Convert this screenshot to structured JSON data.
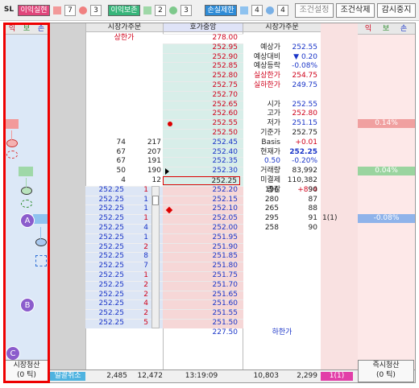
{
  "toolbar": {
    "sl": "SL",
    "profit_stop_tag": "이익실현",
    "n7": "7",
    "n3a": "3",
    "profit_keep_tag": "이익보존",
    "n2": "2",
    "n3b": "3",
    "loss_limit_tag": "손실제한",
    "n4a": "4",
    "n4b": "4",
    "cond_set": "조건설정",
    "cond_delete": "조건삭제",
    "monitor_stop": "감시중지"
  },
  "left_headers": [
    "익",
    "보",
    "손"
  ],
  "right_headers": [
    "익",
    "보",
    "손"
  ],
  "col_headers": {
    "market_order_left": "시장가주문",
    "center": "호가중앙",
    "market_order_right": "시장가주문"
  },
  "upper_limit_label": "상한가",
  "lower_limit_label": "하한가",
  "price_ladder": [
    "278.00",
    "252.95",
    "252.90",
    "252.85",
    "252.80",
    "252.75",
    "252.70",
    "252.65",
    "252.60",
    "252.55",
    "252.50",
    "252.45",
    "252.40",
    "252.35",
    "252.30",
    "252.25",
    "252.20",
    "252.15",
    "252.10",
    "252.05",
    "252.00",
    "251.95",
    "251.90",
    "251.85",
    "251.80",
    "251.75",
    "251.70",
    "251.65",
    "251.60",
    "251.55",
    "251.50",
    "227.50"
  ],
  "info_rows": [
    {
      "label": "예상가",
      "value": "252.55"
    },
    {
      "label": "예상대비",
      "value": "▼ 0.20"
    },
    {
      "label": "예상등락",
      "value": "-0.08%"
    },
    {
      "label": "실상한가",
      "value": "254.75"
    },
    {
      "label": "실하한가",
      "value": "249.75"
    },
    {
      "label": "",
      "value": ""
    },
    {
      "label": "시가",
      "value": "252.55"
    },
    {
      "label": "고가",
      "value": "252.80"
    },
    {
      "label": "저가",
      "value": "251.15"
    },
    {
      "label": "기준가",
      "value": "252.75"
    },
    {
      "label": "Basis",
      "value": "+0.01"
    },
    {
      "label": "현재가",
      "value": "252.25"
    },
    {
      "label": "",
      "value": "-0.20%"
    },
    {
      "label": "거래량",
      "value": "83,992"
    },
    {
      "label": "미결제",
      "value": "110,382"
    },
    {
      "label": "증감",
      "value": "+894"
    }
  ],
  "current_change": "0.50",
  "ask_counts": [
    {
      "cnt": "74",
      "qty": "217"
    },
    {
      "cnt": "67",
      "qty": "207"
    },
    {
      "cnt": "67",
      "qty": "191"
    },
    {
      "cnt": "50",
      "qty": "190"
    },
    {
      "cnt": "4",
      "qty": "12"
    }
  ],
  "bid_counts": [
    {
      "qty": "196",
      "cnt": "90"
    },
    {
      "qty": "280",
      "cnt": "87"
    },
    {
      "qty": "265",
      "cnt": "88"
    },
    {
      "qty": "295",
      "cnt": "91"
    },
    {
      "qty": "258",
      "cnt": "90"
    }
  ],
  "bid_extra": "1(1)",
  "orders": [
    {
      "price": "252.25",
      "qty": "1"
    },
    {
      "price": "252.25",
      "qty": "1"
    },
    {
      "price": "252.25",
      "qty": "1"
    },
    {
      "price": "252.25",
      "qty": "1"
    },
    {
      "price": "252.25",
      "qty": "4"
    },
    {
      "price": "252.25",
      "qty": "1"
    },
    {
      "price": "252.25",
      "qty": "2"
    },
    {
      "price": "252.25",
      "qty": "8"
    },
    {
      "price": "252.25",
      "qty": "7"
    },
    {
      "price": "252.25",
      "qty": "1"
    },
    {
      "price": "252.25",
      "qty": "2"
    },
    {
      "price": "252.25",
      "qty": "2"
    },
    {
      "price": "252.25",
      "qty": "4"
    },
    {
      "price": "252.25",
      "qty": "2"
    },
    {
      "price": "252.25",
      "qty": "5"
    }
  ],
  "pct_labels": [
    "0.14%",
    "0.04%",
    "-0.08%"
  ],
  "footer": {
    "market_clear_left": "시장청산\n(0 틱)",
    "cancel_all": "일괄취소",
    "sum_cnt_left": "2,485",
    "sum_qty_left": "12,472",
    "time": "13:19:09",
    "sum_qty_right": "10,803",
    "sum_cnt_right": "2,299",
    "right_extra": "1(1)",
    "immediate_clear": "즉시청산\n(0 틱)"
  },
  "badges": [
    "A",
    "B",
    "C"
  ]
}
